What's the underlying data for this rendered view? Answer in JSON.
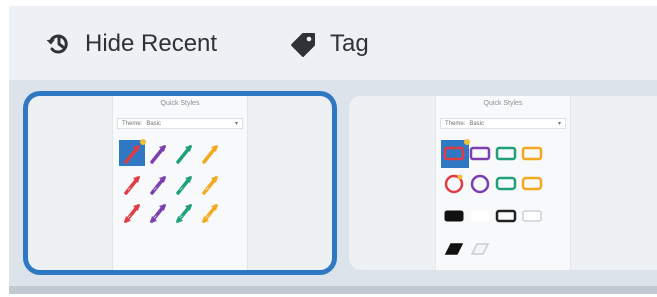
{
  "toolbar": {
    "hide_recent": {
      "label": "Hide Recent",
      "icon": "history-icon"
    },
    "tag": {
      "label": "Tag",
      "icon": "tag-icon"
    }
  },
  "cards": [
    {
      "title": "Quick Styles",
      "theme_label": "Theme:",
      "theme_value": "Basic",
      "style_type": "arrows",
      "selected": true,
      "colors": [
        "#e03c45",
        "#7b3fb0",
        "#1fa07a",
        "#f2a91f"
      ]
    },
    {
      "title": "Quick Styles",
      "theme_label": "Theme:",
      "theme_value": "Basic",
      "style_type": "shapes",
      "selected": false,
      "colors": [
        "#e03c45",
        "#7b3fb0",
        "#1fa07a",
        "#f2a91f"
      ]
    }
  ],
  "colors": {
    "toolbar_bg": "#edf1f5",
    "selection": "#2f78c4",
    "highlight": "#2f78c4"
  }
}
